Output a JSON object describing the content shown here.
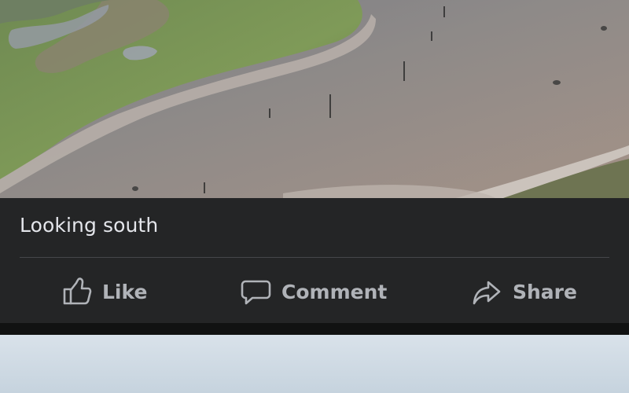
{
  "post": {
    "photo_alt": "Aerial view of marsh and tidal channel",
    "caption": "Looking south"
  },
  "actions": {
    "like": {
      "label": "Like",
      "icon": "thumbs-up-icon"
    },
    "comment": {
      "label": "Comment",
      "icon": "speech-bubble-icon"
    },
    "share": {
      "label": "Share",
      "icon": "share-arrow-icon"
    }
  },
  "colors": {
    "background": "#242526",
    "text": "#e4e6eb",
    "action_text": "#b0b3b8",
    "divider": "#45474a"
  }
}
